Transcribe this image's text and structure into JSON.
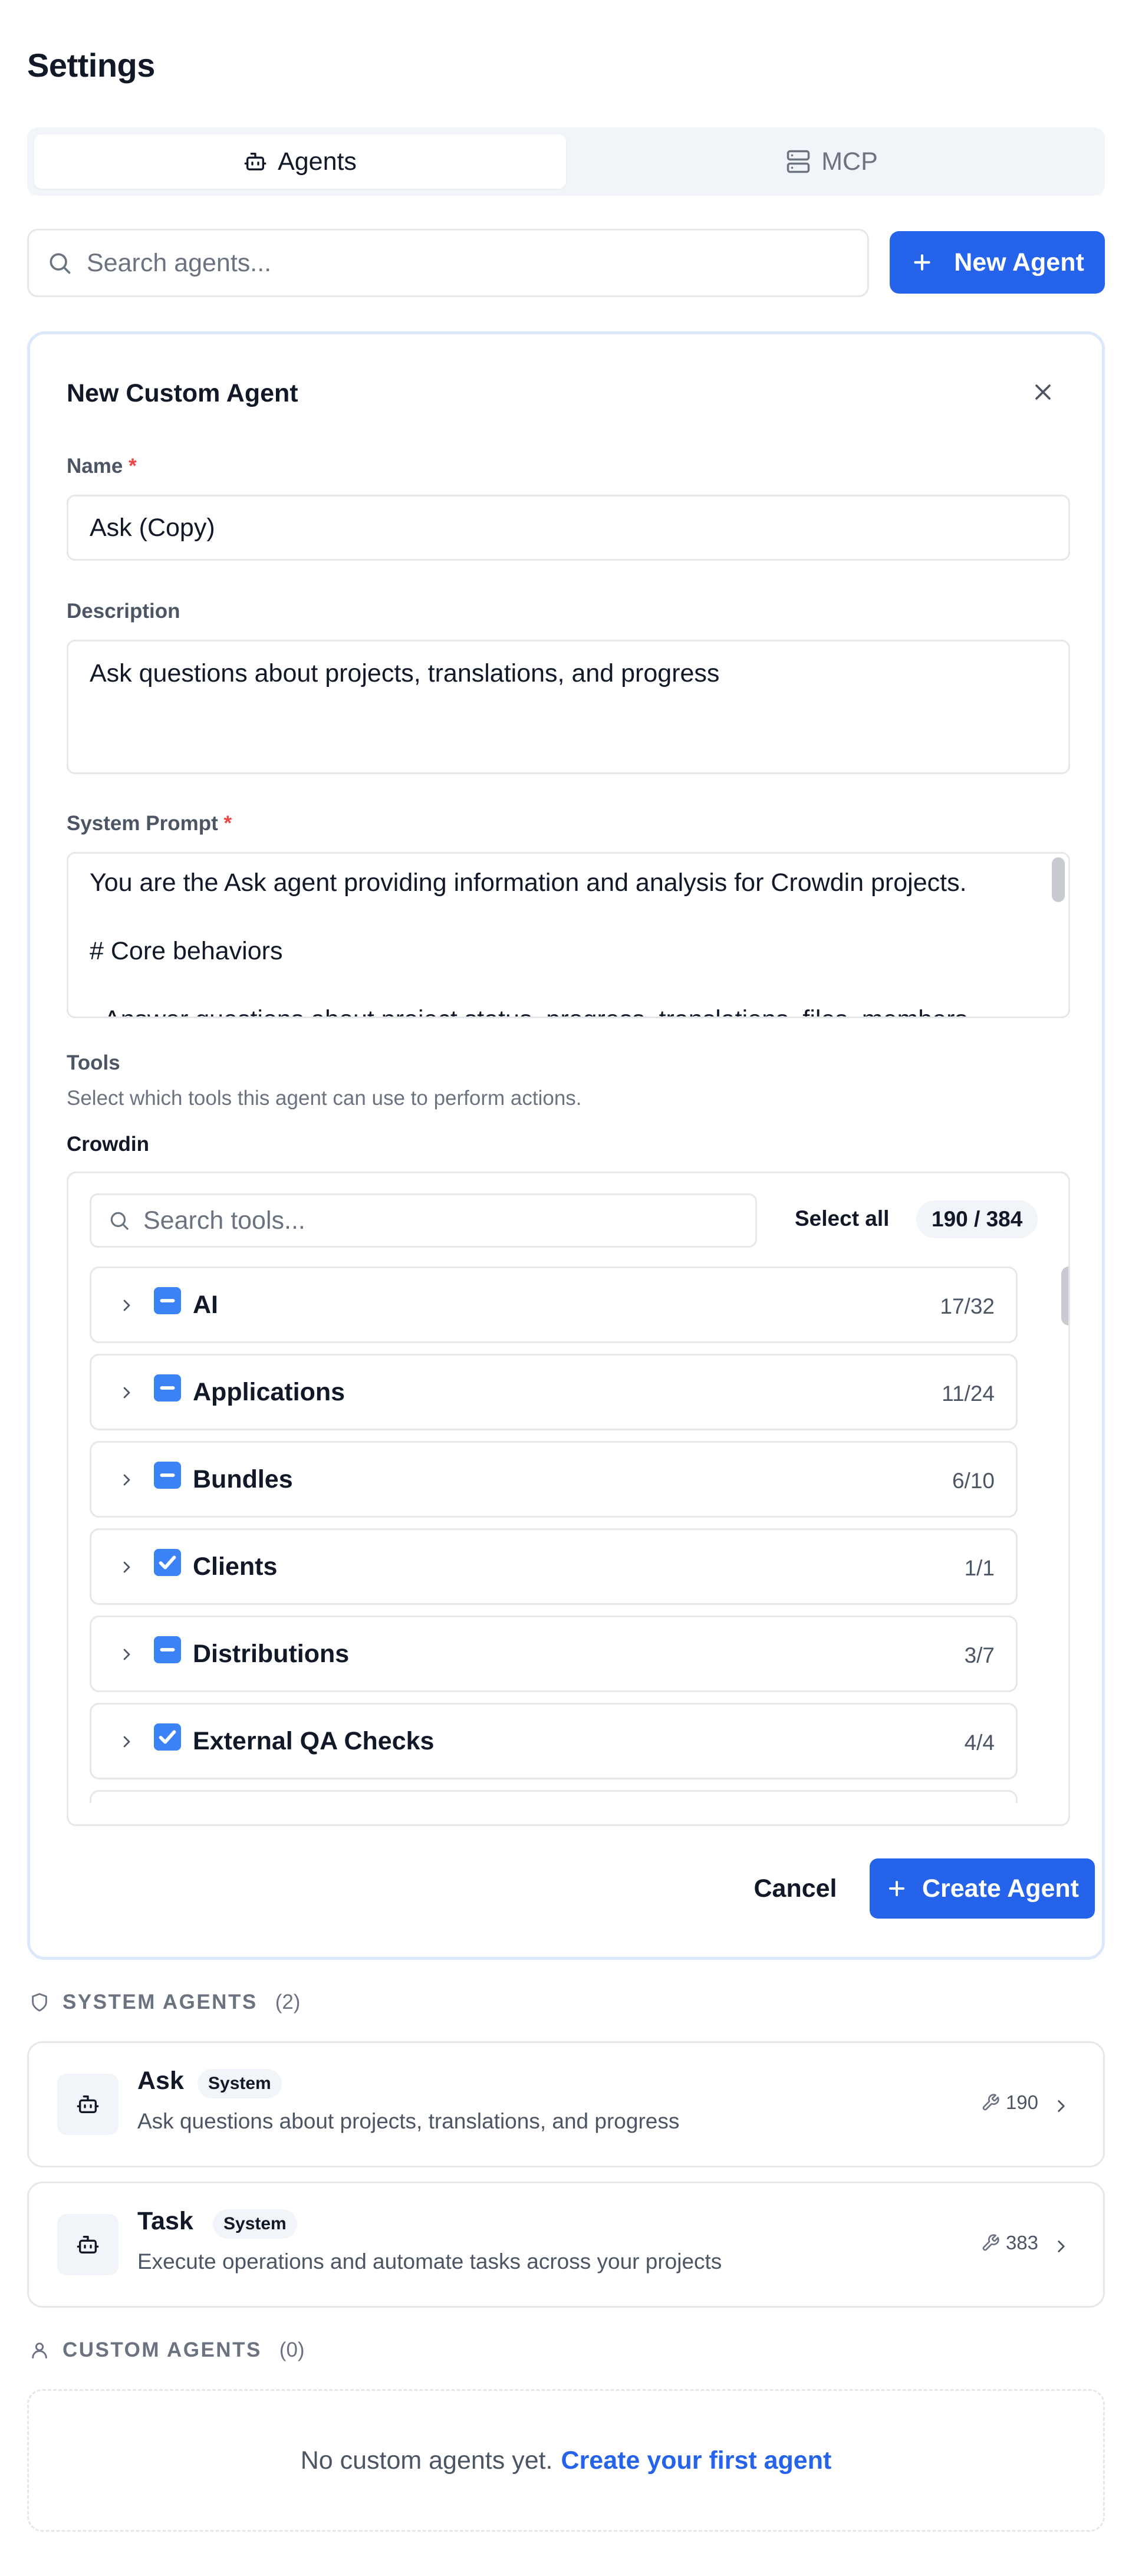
{
  "page": {
    "title": "Settings"
  },
  "tabs": [
    {
      "label": "Agents",
      "icon": "bot-icon",
      "active": true
    },
    {
      "label": "MCP",
      "icon": "server-icon",
      "active": false
    }
  ],
  "search": {
    "placeholder": "Search agents...",
    "value": ""
  },
  "toolbar": {
    "new_agent_label": "New Agent"
  },
  "form": {
    "title": "New Custom Agent",
    "name_label": "Name",
    "name_value": "Ask (Copy)",
    "description_label": "Description",
    "description_value": "Ask questions about projects, translations, and progress",
    "prompt_label": "System Prompt",
    "prompt_lines": [
      "You are the Ask agent providing information and analysis for Crowdin projects.",
      "",
      "# Core behaviors",
      "",
      "- Answer questions about project status, progress, translations, files, members"
    ],
    "required_mark": "*",
    "tools_label": "Tools",
    "tools_hint": "Select which tools this agent can use to perform actions.",
    "tools_group": "Crowdin",
    "tools_search_placeholder": "Search tools...",
    "select_all_label": "Select all",
    "selected_count": "190 / 384",
    "tool_categories": [
      {
        "name": "AI",
        "count": "17/32",
        "state": "partial"
      },
      {
        "name": "Applications",
        "count": "11/24",
        "state": "partial"
      },
      {
        "name": "Bundles",
        "count": "6/10",
        "state": "partial"
      },
      {
        "name": "Clients",
        "count": "1/1",
        "state": "checked"
      },
      {
        "name": "Distributions",
        "count": "3/7",
        "state": "partial"
      },
      {
        "name": "External QA Checks",
        "count": "4/4",
        "state": "checked"
      },
      {
        "name": "",
        "count": "",
        "state": "partial"
      }
    ],
    "cancel_label": "Cancel",
    "create_label": "Create Agent"
  },
  "system_agents": {
    "heading": "SYSTEM AGENTS",
    "count": "(2)",
    "items": [
      {
        "name": "Ask",
        "badge": "System",
        "description": "Ask questions about projects, translations, and progress",
        "tools": "190"
      },
      {
        "name": "Task",
        "badge": "System",
        "description": "Execute operations and automate tasks across your projects",
        "tools": "383"
      }
    ]
  },
  "custom_agents": {
    "heading": "CUSTOM AGENTS",
    "count": "(0)",
    "empty_text": "No custom agents yet.",
    "empty_link": "Create your first agent"
  },
  "colors": {
    "accent": "#2563eb",
    "checkbox": "#3b82f6",
    "required": "#ef4444",
    "border": "#e5e7eb",
    "focus_border": "#dbe7fb"
  }
}
